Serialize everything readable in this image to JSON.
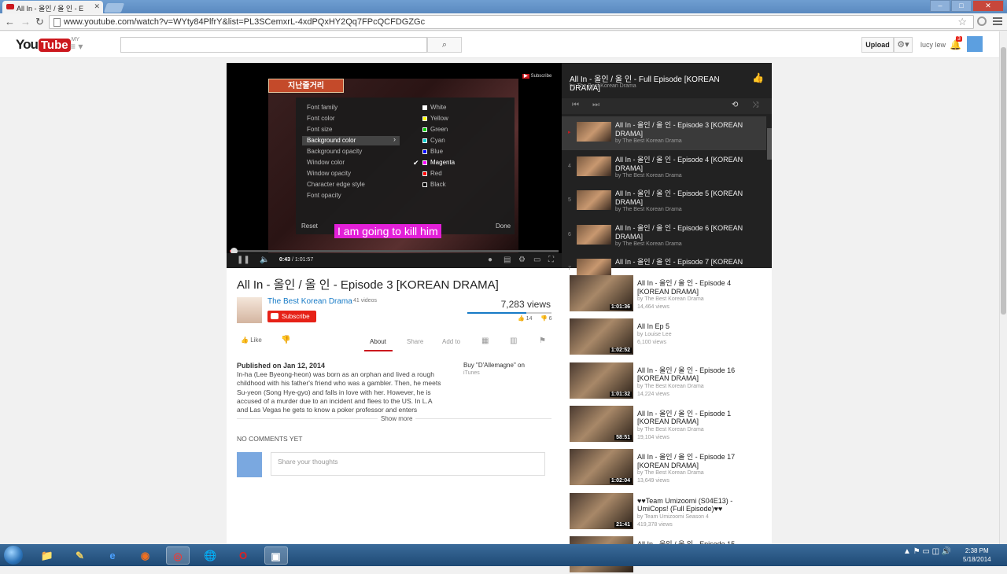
{
  "browser": {
    "tab_title": "All In - 올인 / 올 인 - E",
    "url": "www.youtube.com/watch?v=WYty84PlfrY&list=PL3SCemxrL-4xdPQxHY2Qq7FPcQCFDGZGc",
    "icons": {
      "back": "back-arrow-icon",
      "forward": "forward-arrow-icon",
      "reload": "reload-icon",
      "star": "bookmark-star-icon",
      "menu": "hamburger-menu-icon"
    }
  },
  "header": {
    "logo_you": "You",
    "logo_tube": "Tube",
    "logo_country": "MY",
    "search_placeholder": "",
    "upload_label": "Upload",
    "user_name": "lucy lew",
    "notification_count": "3"
  },
  "player": {
    "title_card_text": "지난줄거리",
    "subscribe_watermark": "Subscribe",
    "subtitle_text": "I am going to kill him",
    "time_current": "0:43",
    "time_total": "/ 1:01:57",
    "progress_fraction": 0.012,
    "caption_menu": {
      "options": [
        "Font family",
        "Font color",
        "Font size",
        "Background color",
        "Background opacity",
        "Window color",
        "Window opacity",
        "Character edge style",
        "Font opacity"
      ],
      "selected_option": "Background color",
      "colors": [
        {
          "name": "White",
          "hex": "#ffffff"
        },
        {
          "name": "Yellow",
          "hex": "#ffff00"
        },
        {
          "name": "Green",
          "hex": "#00cc00"
        },
        {
          "name": "Cyan",
          "hex": "#00cccc"
        },
        {
          "name": "Blue",
          "hex": "#0000ff"
        },
        {
          "name": "Magenta",
          "hex": "#ff00ff"
        },
        {
          "name": "Red",
          "hex": "#ff0000"
        },
        {
          "name": "Black",
          "hex": "#000000"
        }
      ],
      "selected_color": "Magenta",
      "reset_label": "Reset",
      "done_label": "Done"
    }
  },
  "playlist": {
    "title": "All In - 올인 / 올 인 - Full Episode [KOREAN DRAMA]",
    "by": "by The Best Korean Drama",
    "items": [
      {
        "num": "▸",
        "title": "All In - 올인 / 올 인 - Episode 3 [KOREAN DRAMA]",
        "by": "by The Best Korean Drama"
      },
      {
        "num": "4",
        "title": "All In - 올인 / 올 인 - Episode 4 [KOREAN DRAMA]",
        "by": "by The Best Korean Drama"
      },
      {
        "num": "5",
        "title": "All In - 올인 / 올 인 - Episode 5 [KOREAN DRAMA]",
        "by": "by The Best Korean Drama"
      },
      {
        "num": "6",
        "title": "All In - 올인 / 올 인 - Episode 6 [KOREAN DRAMA]",
        "by": "by The Best Korean Drama"
      },
      {
        "num": "7",
        "title": "All In - 올인 / 올 인 - Episode 7 [KOREAN",
        "by": ""
      }
    ]
  },
  "video": {
    "title": "All In - 올인 / 올 인 - Episode 3 [KOREAN DRAMA]",
    "channel": "The Best Korean Drama",
    "channel_videos": "41 videos",
    "subscribe_label": "Subscribe",
    "views": "7,283 views",
    "likes": "14",
    "dislikes": "6",
    "like_fraction": 0.7,
    "like_label": "Like",
    "tabs": [
      "About",
      "Share",
      "Add to"
    ],
    "published": "Published on Jan 12, 2014",
    "description": "In-ha (Lee Byeong-heon) was born as an orphan and lived a rough childhood with his father's friend who was a gambler. Then, he meets Su-yeon (Song Hye-gyo) and falls in love with her. However, he is accused of a murder due to an incident and flees to the US. In L.A and Las Vegas he gets to know a poker professor and enters",
    "buy_text": "Buy \"D'Allemagne\" on",
    "itunes": "iTunes",
    "show_more": "Show more",
    "no_comments": "NO COMMENTS YET",
    "comment_placeholder": "Share your thoughts"
  },
  "related": [
    {
      "title": "All In - 올인 / 올 인 - Episode 4 [KOREAN DRAMA]",
      "by": "by The Best Korean Drama",
      "views": "14,464 views",
      "duration": "1:01:36"
    },
    {
      "title": "All In Ep 5",
      "by": "by Louise Lee",
      "views": "6,100 views",
      "duration": "1:02:52"
    },
    {
      "title": "All In - 올인 / 올 인 - Episode 16 [KOREAN DRAMA]",
      "by": "by The Best Korean Drama",
      "views": "14,224 views",
      "duration": "1:01:32"
    },
    {
      "title": "All In - 올인 / 올 인 - Episode 1 [KOREAN DRAMA]",
      "by": "by The Best Korean Drama",
      "views": "19,104 views",
      "duration": "58:51"
    },
    {
      "title": "All In - 올인 / 올 인 - Episode 17 [KOREAN DRAMA]",
      "by": "by The Best Korean Drama",
      "views": "13,649 views",
      "duration": "1:02:04"
    },
    {
      "title": "♥♥Team Umizoomi (S04E13) - UmiCops! (Full Episode)♥♥",
      "by": "by Team Umizoomi Season 4",
      "views": "419,378 views",
      "duration": "21:41"
    },
    {
      "title": "All In - 올인 / 올 인 - Episode 15",
      "by": "",
      "views": "",
      "duration": ""
    }
  ],
  "taskbar": {
    "time": "2:38 PM",
    "date": "5/18/2014",
    "apps": [
      "windows-explorer-icon",
      "pencil-app-icon",
      "internet-explorer-icon",
      "firefox-icon",
      "chrome-icon",
      "network-globe-icon",
      "opera-icon",
      "window-app-icon"
    ]
  }
}
